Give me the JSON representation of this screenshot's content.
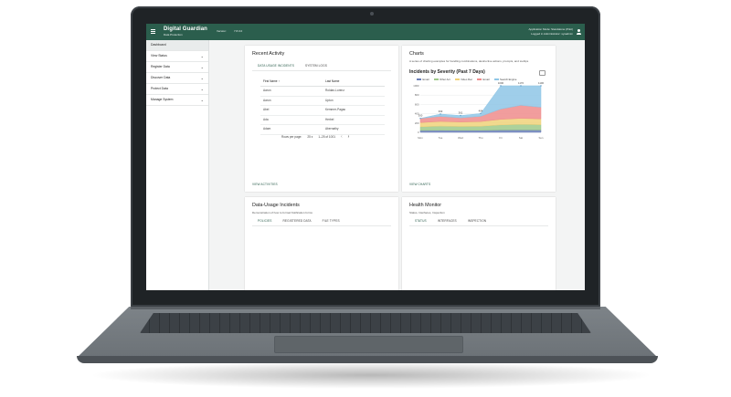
{
  "app": {
    "brand": "Digital Guardian",
    "brand_sub": "Data Protection",
    "version_label": "Version:",
    "version_value": "7.8.0.0",
    "app_mode": "Application Mode: Standalone (Pilot)",
    "logged_in": "Logged in Administrator: sysadmin"
  },
  "sidebar": {
    "items": [
      {
        "label": "Dashboard",
        "expandable": false
      },
      {
        "label": "View Status",
        "expandable": true
      },
      {
        "label": "Register Data",
        "expandable": true
      },
      {
        "label": "Discover Data",
        "expandable": true
      },
      {
        "label": "Protect Data",
        "expandable": true
      },
      {
        "label": "Manage System",
        "expandable": true
      }
    ]
  },
  "recent_activity": {
    "title": "Recent Activity",
    "tabs": [
      "DATA USAGE INCIDENTS",
      "SYSTEM LOGS"
    ],
    "columns": [
      "First Name ↑",
      "Last Name"
    ],
    "rows": [
      [
        "Aaron",
        "Roldan-Lorenz"
      ],
      [
        "Aaron",
        "Upton"
      ],
      [
        "Abel",
        "Kemmer-Pagac"
      ],
      [
        "Ada",
        "Herbel"
      ],
      [
        "Adam",
        "Abernathy"
      ]
    ],
    "rows_per_page_label": "Rows per page:",
    "rows_per_page_value": "25",
    "range": "1–25 of 1001",
    "link": "VIEW ACTIVITIES"
  },
  "charts_card": {
    "title": "Charts",
    "description": "A series of charting examples for handling combinations, destructive actions, prompts, and tooltips",
    "link": "VIEW CHARTS"
  },
  "chart_data": {
    "type": "area",
    "title": "Incidents by Severity (Past 7 Days)",
    "categories": [
      "Mon",
      "Tue",
      "Wed",
      "Thu",
      "Fri",
      "Sat",
      "Sun"
    ],
    "ylim": [
      0,
      1000
    ],
    "yticks": [
      0,
      200,
      400,
      600,
      800,
      1000
    ],
    "totals_labels": [
      "300",
      "393",
      "361",
      "404",
      "1000",
      "1170",
      "1100"
    ],
    "series": [
      {
        "name": "Email",
        "color": "#6b7fb8",
        "values": [
          40,
          45,
          42,
          44,
          50,
          52,
          50
        ]
      },
      {
        "name": "Other Act",
        "color": "#9ec98a",
        "values": [
          80,
          90,
          85,
          88,
          110,
          120,
          115
        ]
      },
      {
        "name": "Video Rec",
        "color": "#f0d27a",
        "values": [
          90,
          100,
          95,
          100,
          120,
          130,
          125
        ]
      },
      {
        "name": "Email",
        "color": "#ef8c8c",
        "values": [
          90,
          108,
          90,
          112,
          220,
          280,
          250
        ]
      },
      {
        "name": "Search Engine",
        "color": "#8ec6e6",
        "values": [
          0,
          50,
          49,
          60,
          500,
          588,
          560
        ]
      }
    ],
    "legend_position": "top",
    "grid": true
  },
  "incidents_card": {
    "title": "Data-Usage Incidents",
    "description": "Demonstration of how to format Notification forms",
    "tabs": [
      "POLICIES",
      "REGISTERED DATA",
      "FILE TYPES"
    ]
  },
  "health_card": {
    "title": "Health Monitor",
    "description": "Status, Interfaces, Inspection",
    "tabs": [
      "STATUS",
      "INTERFACES",
      "INSPECTION"
    ]
  }
}
